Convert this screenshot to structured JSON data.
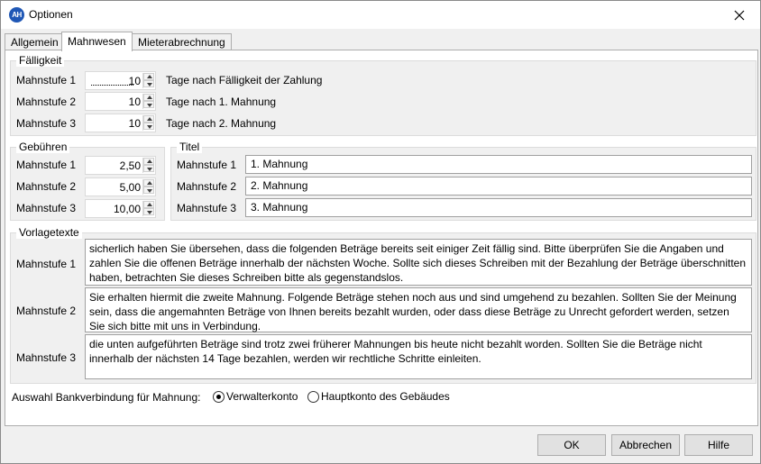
{
  "window": {
    "icon_text": "AH",
    "title": "Optionen"
  },
  "tabs": [
    {
      "label": "Allgemein",
      "active": false
    },
    {
      "label": "Mahnwesen",
      "active": true
    },
    {
      "label": "Mieterabrechnung",
      "active": false
    }
  ],
  "faelligkeit": {
    "title": "Fälligkeit",
    "rows": [
      {
        "label": "Mahnstufe 1",
        "value": "10",
        "suffix": "Tage nach Fälligkeit der Zahlung"
      },
      {
        "label": "Mahnstufe 2",
        "value": "10",
        "suffix": "Tage nach 1. Mahnung"
      },
      {
        "label": "Mahnstufe 3",
        "value": "10",
        "suffix": "Tage nach 2. Mahnung"
      }
    ]
  },
  "gebuehren": {
    "title": "Gebühren",
    "rows": [
      {
        "label": "Mahnstufe 1",
        "value": "2,50"
      },
      {
        "label": "Mahnstufe 2",
        "value": "5,00"
      },
      {
        "label": "Mahnstufe 3",
        "value": "10,00"
      }
    ]
  },
  "titel": {
    "title": "Titel",
    "rows": [
      {
        "label": "Mahnstufe 1",
        "value": "1. Mahnung"
      },
      {
        "label": "Mahnstufe 2",
        "value": "2. Mahnung"
      },
      {
        "label": "Mahnstufe 3",
        "value": "3. Mahnung"
      }
    ]
  },
  "vorlagetexte": {
    "title": "Vorlagetexte",
    "rows": [
      {
        "label": "Mahnstufe 1",
        "text": "sicherlich haben Sie übersehen, dass die folgenden Beträge bereits seit einiger Zeit fällig sind. Bitte überprüfen Sie die Angaben und zahlen Sie die offenen Beträge innerhalb der nächsten Woche. Sollte sich dieses Schreiben mit der Bezahlung der Beträge überschnitten haben, betrachten Sie dieses Schreiben bitte als gegenstandslos."
      },
      {
        "label": "Mahnstufe 2",
        "text": "Sie erhalten hiermit die zweite Mahnung. Folgende Beträge stehen noch aus und sind umgehend zu bezahlen. Sollten Sie der Meinung sein, dass die angemahnten Beträge von Ihnen bereits bezahlt wurden, oder dass diese Beträge zu Unrecht gefordert werden, setzen Sie sich bitte mit uns in Verbindung."
      },
      {
        "label": "Mahnstufe 3",
        "text": "die unten aufgeführten Beträge sind trotz zwei früherer Mahnungen bis heute nicht bezahlt worden. Sollten Sie die Beträge nicht innerhalb der nächsten 14 Tage bezahlen, werden wir rechtliche Schritte einleiten."
      }
    ]
  },
  "bank": {
    "label": "Auswahl Bankverbindung für Mahnung:",
    "options": [
      {
        "label": "Verwalterkonto",
        "selected": true
      },
      {
        "label": "Hauptkonto des Gebäudes",
        "selected": false
      }
    ]
  },
  "buttons": {
    "ok": "OK",
    "cancel": "Abbrechen",
    "help": "Hilfe"
  }
}
